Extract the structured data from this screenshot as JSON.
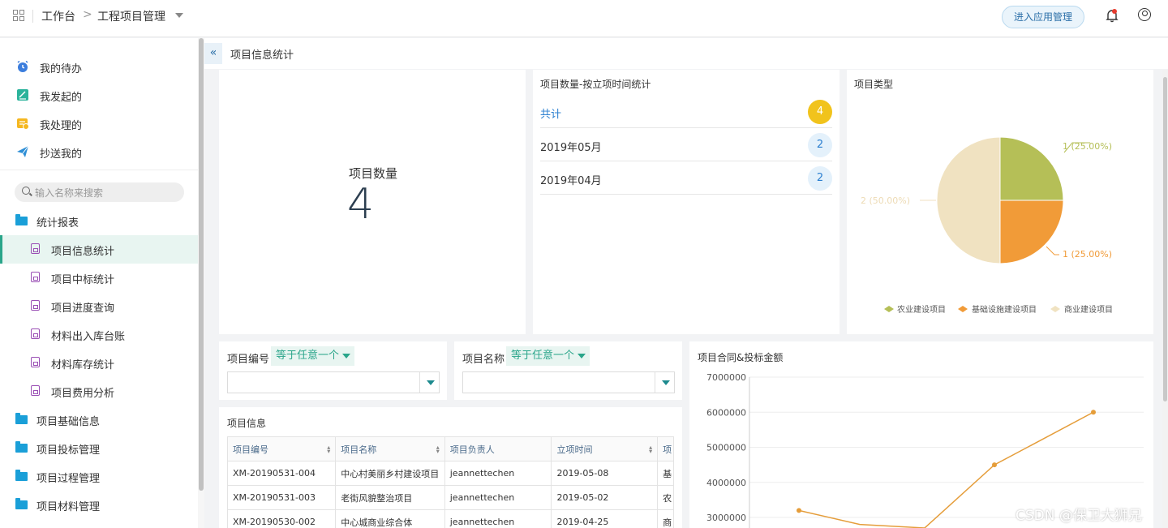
{
  "header": {
    "crumb_root": "工作台",
    "crumb_separator": ">",
    "crumb_current": "工程项目管理",
    "enter_app_button": "进入应用管理"
  },
  "sidebar": {
    "quick_items": [
      {
        "label": "我的待办",
        "icon": "alarm-clock-icon"
      },
      {
        "label": "我发起的",
        "icon": "edit-note-icon"
      },
      {
        "label": "我处理的",
        "icon": "task-done-icon"
      },
      {
        "label": "抄送我的",
        "icon": "paper-plane-icon"
      }
    ],
    "search_placeholder": "输入名称来搜索",
    "groups": [
      {
        "label": "统计报表",
        "items": [
          {
            "label": "项目信息统计",
            "active": true
          },
          {
            "label": "项目中标统计"
          },
          {
            "label": "项目进度查询"
          },
          {
            "label": "材料出入库台账"
          },
          {
            "label": "材料库存统计"
          },
          {
            "label": "项目费用分析"
          }
        ]
      },
      {
        "label": "项目基础信息"
      },
      {
        "label": "项目投标管理"
      },
      {
        "label": "项目过程管理"
      },
      {
        "label": "项目材料管理"
      }
    ]
  },
  "tab": {
    "back_icon": "«",
    "title": "项目信息统计"
  },
  "kpi": {
    "label": "项目数量",
    "value": "4"
  },
  "time_stats": {
    "title": "项目数量-按立项时间统计",
    "rows": [
      {
        "label": "共计",
        "count": "4",
        "color": "#f1c31c"
      },
      {
        "label": "2019年05月",
        "count": "2",
        "color": "#e4f1fb"
      },
      {
        "label": "2019年04月",
        "count": "2",
        "color": "#e4f1fb"
      }
    ]
  },
  "type_pie": {
    "title": "项目类型",
    "slices": [
      {
        "name": "农业建设项目",
        "value": 1,
        "label": "1 (25.00%)",
        "color": "#b5bf57"
      },
      {
        "name": "基础设施建设项目",
        "value": 1,
        "label": "1 (25.00%)",
        "color": "#f19b38"
      },
      {
        "name": "商业建设项目",
        "value": 2,
        "label": "2 (50.00%)",
        "color": "#f0e2c1"
      }
    ]
  },
  "filters": [
    {
      "label": "项目编号",
      "op": "等于任意一个"
    },
    {
      "label": "项目名称",
      "op": "等于任意一个"
    }
  ],
  "table": {
    "title": "项目信息",
    "columns": [
      "项目编号",
      "项目名称",
      "项目负责人",
      "立项时间",
      "项"
    ],
    "rows": [
      [
        "XM-20190531-004",
        "中心村美丽乡村建设项目",
        "jeannettechen",
        "2019-05-08",
        "基"
      ],
      [
        "XM-20190531-003",
        "老街风貌整治项目",
        "jeannettechen",
        "2019-05-02",
        "农"
      ],
      [
        "XM-20190530-002",
        "中心城商业综合体",
        "jeannettechen",
        "2019-04-25",
        "商"
      ]
    ]
  },
  "chart_data": {
    "type": "line",
    "title": "项目合同&投标金额",
    "ylim": [
      3000000,
      7000000
    ],
    "yticks": [
      "7000000",
      "6000000",
      "5000000",
      "4000000",
      "3000000"
    ],
    "series": [
      {
        "values": [
          3200000,
          2800000,
          2700000,
          4500000,
          6000000
        ],
        "color": "#e59d3a"
      }
    ]
  },
  "watermark": "CSDN @保卫大狮兄"
}
